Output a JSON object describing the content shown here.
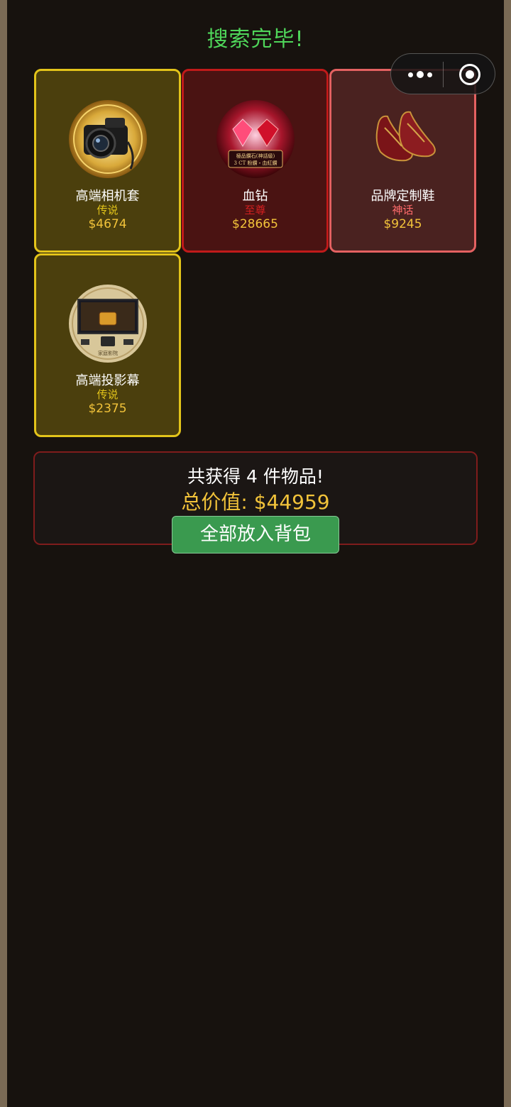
{
  "header": {
    "title": "搜索完毕!"
  },
  "capsule": {
    "more_icon": "more-dots-icon",
    "close_icon": "target-circle-icon"
  },
  "items": [
    {
      "name": "高端相机套",
      "rarity": "传说",
      "price": "$4674",
      "rarity_color": "#e3c41a",
      "icon": "camera-icon"
    },
    {
      "name": "血钻",
      "rarity": "至尊",
      "price": "$28665",
      "rarity_color": "#d42020",
      "icon": "red-diamond-icon",
      "image_text_1": "極品鑽石(神話級)",
      "image_text_2": "3 CT 粉鑽・血紅鑽"
    },
    {
      "name": "品牌定制鞋",
      "rarity": "神话",
      "price": "$9245",
      "rarity_color": "#ff6b6b",
      "icon": "shoes-icon"
    },
    {
      "name": "高端投影幕",
      "rarity": "传说",
      "price": "$2375",
      "rarity_color": "#e3c41a",
      "icon": "projector-screen-icon",
      "image_text_1": "家庭影院"
    }
  ],
  "summary": {
    "count_text": "共获得 4 件物品!",
    "total_text": "总价值: $44959",
    "button_label": "全部放入背包"
  },
  "colors": {
    "legend_border": "#e3c41a",
    "supreme_border": "#c01a1a",
    "myth_border": "#e46161",
    "title_green": "#4fd65a",
    "button_green": "#3a9a4f"
  }
}
